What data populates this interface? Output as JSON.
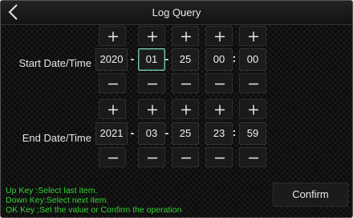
{
  "header": {
    "title": "Log Query"
  },
  "start": {
    "label": "Start Date/Time",
    "year": "2020",
    "month": "01",
    "day": "25",
    "hour": "00",
    "minute": "00"
  },
  "end": {
    "label": "End Date/Time",
    "year": "2021",
    "month": "03",
    "day": "25",
    "hour": "23",
    "minute": "59"
  },
  "separators": {
    "date": "-",
    "time": ":"
  },
  "help": [
    "Up Key  :Select last item.",
    "Down Key:Select next item.",
    "OK Key  ;Set the value or Confirm the operation"
  ],
  "confirm_label": "Confirm",
  "icons": {
    "back": "chevron-left-icon",
    "increment": "plus-icon",
    "decrement": "minus-icon"
  },
  "colors": {
    "help_text": "#32d232",
    "focus_border": "#7fbfa0",
    "background": "#0c0c0c"
  }
}
